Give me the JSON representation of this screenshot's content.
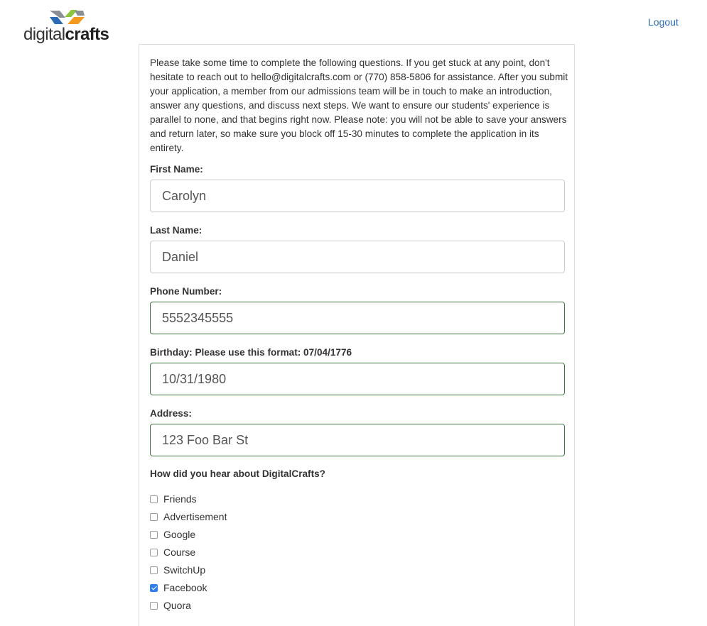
{
  "header": {
    "logo_light": "digital",
    "logo_bold": "crafts",
    "logout_label": "Logout"
  },
  "form": {
    "intro": "Please take some time to complete the following questions. If you get stuck at any point, don't hesitate to reach out to hello@digitalcrafts.com or (770) 858-5806 for assistance. After you submit your application, a member from our admissions team will be in touch to make an introduction, answer any questions, and discuss next steps. We want to ensure our students' experience is parallel to none, and that begins right now. Please note: you will not be able to save your answers and return later, so make sure you block off 15-30 minutes to complete the application in its entirety.",
    "first_name": {
      "label": "First Name:",
      "value": "Carolyn"
    },
    "last_name": {
      "label": "Last Name:",
      "value": "Daniel"
    },
    "phone": {
      "label": "Phone Number:",
      "value": "5552345555"
    },
    "birthday": {
      "label": "Birthday: Please use this format: 07/04/1776",
      "value": "10/31/1980"
    },
    "address": {
      "label": "Address:",
      "value": "123 Foo Bar St"
    },
    "heard_question": "How did you hear about DigitalCrafts?",
    "options": [
      {
        "label": "Friends",
        "checked": false
      },
      {
        "label": "Advertisement",
        "checked": false
      },
      {
        "label": "Google",
        "checked": false
      },
      {
        "label": "Course",
        "checked": false
      },
      {
        "label": "SwitchUp",
        "checked": false
      },
      {
        "label": "Facebook",
        "checked": true
      },
      {
        "label": "Quora",
        "checked": false
      }
    ]
  },
  "colors": {
    "link": "#2a6bb3",
    "valid_border": "#3c763d",
    "checkbox_checked": "#2f80ed",
    "logo_blue": "#2a6bb3",
    "logo_gray": "#8a8f96",
    "logo_green": "#8cc63f",
    "logo_orange": "#f39a1e"
  }
}
